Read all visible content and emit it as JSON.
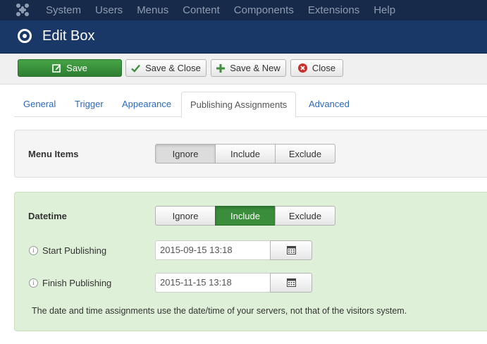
{
  "topnav": {
    "logo_icon": "joomla-logo-icon",
    "items": [
      "System",
      "Users",
      "Menus",
      "Content",
      "Components",
      "Extensions",
      "Help"
    ]
  },
  "header": {
    "icon": "target-icon",
    "title": "Edit Box"
  },
  "toolbar": {
    "save": "Save",
    "save_close": "Save & Close",
    "save_new": "Save & New",
    "close": "Close"
  },
  "tabs": [
    "General",
    "Trigger",
    "Appearance",
    "Publishing Assignments",
    "Advanced"
  ],
  "active_tab": "Publishing Assignments",
  "menu_items": {
    "label": "Menu Items",
    "options": [
      "Ignore",
      "Include",
      "Exclude"
    ],
    "selected": "Ignore"
  },
  "datetime": {
    "label": "Datetime",
    "options": [
      "Ignore",
      "Include",
      "Exclude"
    ],
    "selected": "Include",
    "start_label": "Start Publishing",
    "start_value": "2015-09-15 13:18",
    "finish_label": "Finish Publishing",
    "finish_value": "2015-11-15 13:18",
    "note": "The date and time assignments use the date/time of your servers, not that of the visitors system."
  },
  "colors": {
    "nav_bg": "#182a4a",
    "header_bg": "#1a3867",
    "save_green": "#46a546",
    "link_blue": "#2a69b8",
    "success_bg": "#dff0d8"
  }
}
